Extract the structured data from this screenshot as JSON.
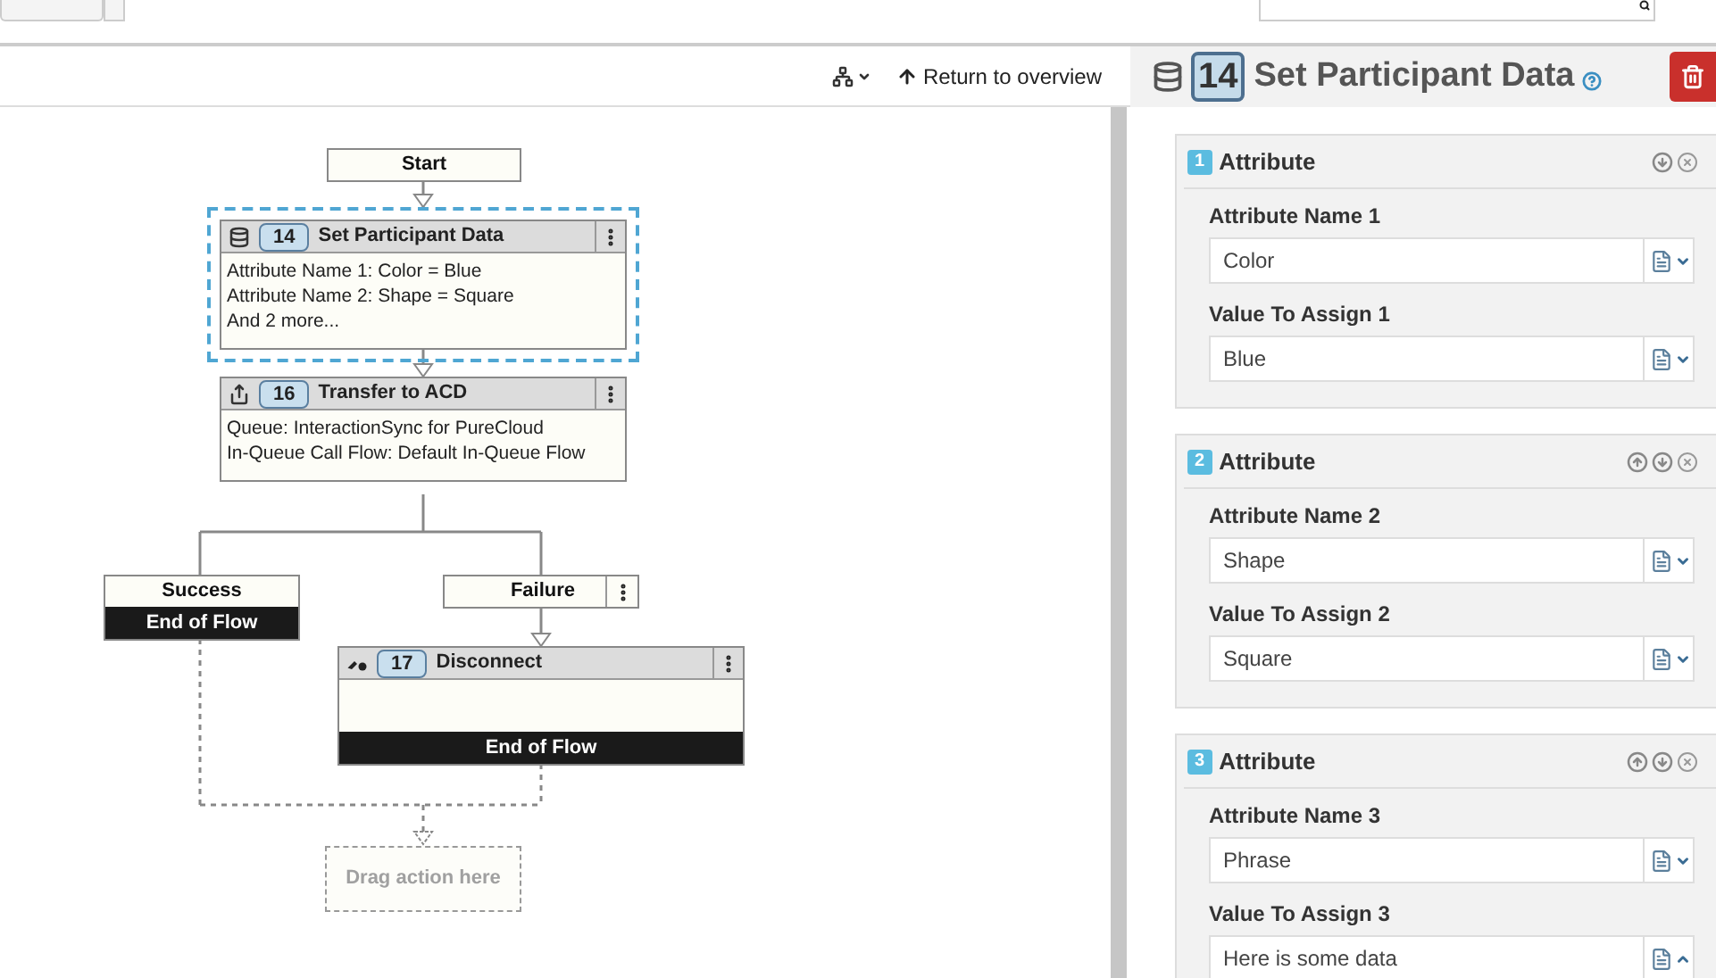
{
  "toolbar": {
    "overview_link": "Return to overview"
  },
  "flow": {
    "start": "Start",
    "actions": [
      {
        "kind": "data",
        "number": "14",
        "title": "Set Participant Data",
        "selected": true,
        "lines": [
          "Attribute Name 1: Color = Blue",
          "Attribute Name 2: Shape = Square",
          "And 2 more..."
        ]
      },
      {
        "kind": "transfer",
        "number": "16",
        "title": "Transfer to ACD",
        "selected": false,
        "lines": [
          "Queue: InteractionSync for PureCloud",
          "In-Queue Call Flow: Default In-Queue Flow"
        ]
      }
    ],
    "branches": [
      {
        "label": "Success",
        "end": "End of Flow",
        "has_menu": false
      },
      {
        "label": "Failure",
        "has_menu": true
      }
    ],
    "failure_action": {
      "kind": "disconnect",
      "number": "17",
      "title": "Disconnect",
      "selected": false,
      "end": "End of Flow"
    },
    "drop_target": "Drag action here"
  },
  "panel": {
    "kind": "data",
    "number": "14",
    "title": "Set Participant Data",
    "attributes": [
      {
        "number": "1",
        "title": "Attribute",
        "can_move_up": false,
        "can_move_down": true,
        "name_label": "Attribute Name 1",
        "name_value": "Color",
        "value_label": "Value To Assign 1",
        "value_value": "Blue",
        "value_expanded": false
      },
      {
        "number": "2",
        "title": "Attribute",
        "can_move_up": true,
        "can_move_down": true,
        "name_label": "Attribute Name 2",
        "name_value": "Shape",
        "value_label": "Value To Assign 2",
        "value_value": "Square",
        "value_expanded": false
      },
      {
        "number": "3",
        "title": "Attribute",
        "can_move_up": true,
        "can_move_down": true,
        "name_label": "Attribute Name 3",
        "name_value": "Phrase",
        "value_label": "Value To Assign 3",
        "value_value": "Here is some data",
        "value_expanded": true
      }
    ]
  }
}
